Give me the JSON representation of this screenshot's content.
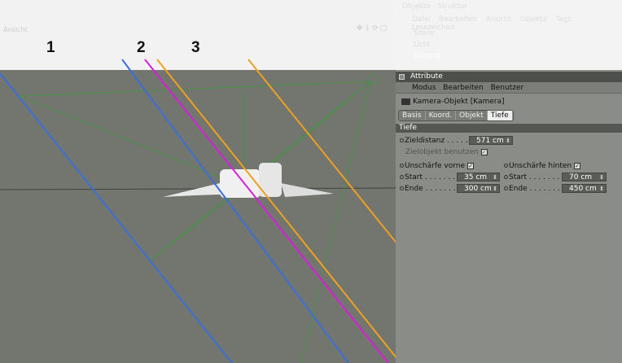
{
  "viewport": {
    "title": "Ansicht",
    "markers": [
      "1",
      "2",
      "3"
    ]
  },
  "objects_panel": {
    "tabs": [
      "Objekte",
      "Struktur"
    ],
    "menu": [
      "Datei",
      "Bearbeiten",
      "Ansicht",
      "Objekte",
      "Tags",
      "Lesezeichen"
    ],
    "items": [
      "Szene",
      "Licht",
      "Kamera"
    ]
  },
  "attributes": {
    "title": "Attribute",
    "menu": [
      "Modus",
      "Bearbeiten",
      "Benutzer"
    ],
    "object": "Kamera-Objekt [Kamera]",
    "tabs": [
      "Basis",
      "Koord.",
      "Objekt",
      "Tiefe"
    ],
    "active_tab": "Tiefe",
    "section": "Tiefe",
    "zieldistanz_label": "Zieldistanz",
    "zieldistanz": "571 cm",
    "zielobjekt_label": "Zielobjekt benutzen",
    "front_label": "Unschärfe vorne",
    "back_label": "Unschärfe hinten",
    "start_label": "Start",
    "end_label": "Ende",
    "front_start": "35 cm",
    "front_end": "300 cm",
    "back_start": "70 cm",
    "back_end": "450 cm"
  },
  "colors": {
    "blue": "#3a6fd8",
    "magenta": "#d81ed8",
    "orange": "#f0a020",
    "green": "#3a9a3a",
    "viewport": "#73756f"
  }
}
